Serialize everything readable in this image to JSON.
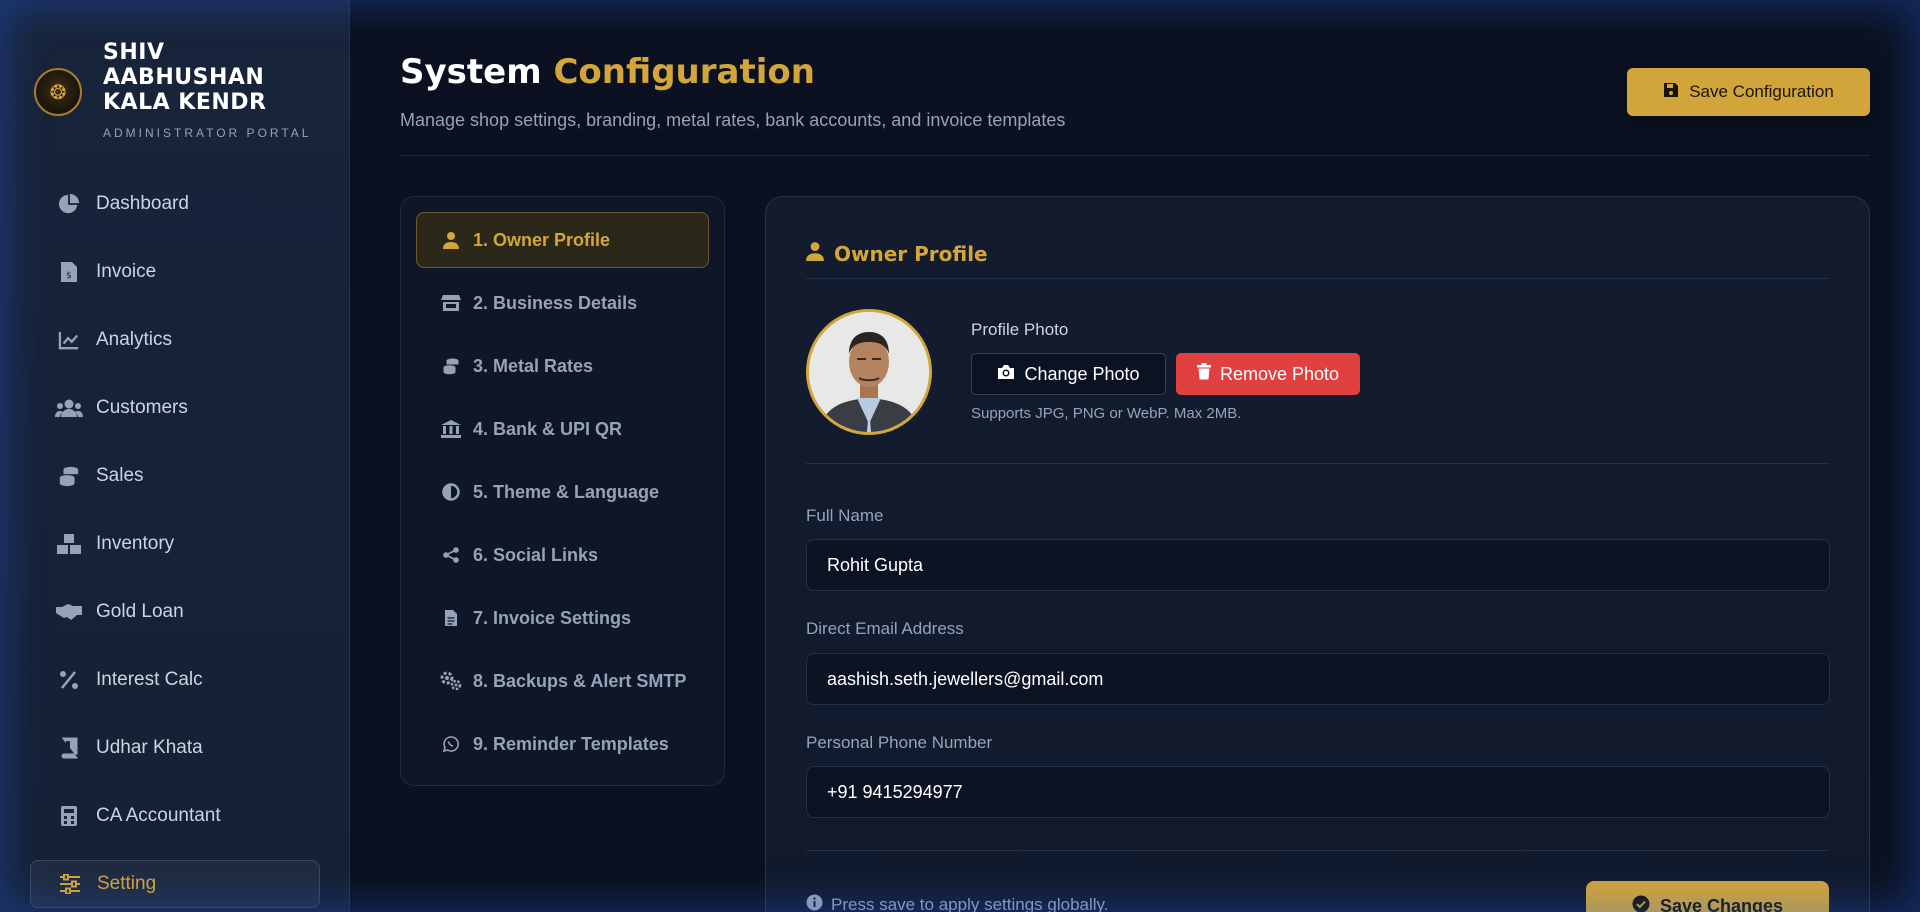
{
  "brand": {
    "name": "SHIV AABHUSHAN KALA KENDR",
    "subtitle": "ADMINISTRATOR PORTAL"
  },
  "sidebar": {
    "items": [
      {
        "label": "Dashboard",
        "icon": "pie-chart-icon"
      },
      {
        "label": "Invoice",
        "icon": "invoice-icon"
      },
      {
        "label": "Analytics",
        "icon": "line-chart-icon"
      },
      {
        "label": "Customers",
        "icon": "users-icon"
      },
      {
        "label": "Sales",
        "icon": "coins-icon"
      },
      {
        "label": "Inventory",
        "icon": "boxes-icon"
      },
      {
        "label": "Gold Loan",
        "icon": "handshake-icon"
      },
      {
        "label": "Interest Calc",
        "icon": "percent-icon"
      },
      {
        "label": "Udhar Khata",
        "icon": "book-icon"
      },
      {
        "label": "CA Accountant",
        "icon": "calculator-icon"
      },
      {
        "label": "Setting",
        "icon": "sliders-icon",
        "active": true
      }
    ]
  },
  "header": {
    "title_part1": "System",
    "title_part2": "Configuration",
    "subtitle": "Manage shop settings, branding, metal rates, bank accounts, and invoice templates",
    "save_label": "Save Configuration"
  },
  "tabs": [
    {
      "label": "1. Owner Profile",
      "icon": "user-icon",
      "active": true
    },
    {
      "label": "2. Business Details",
      "icon": "store-icon"
    },
    {
      "label": "3. Metal Rates",
      "icon": "coins-icon"
    },
    {
      "label": "4. Bank & UPI QR",
      "icon": "bank-icon"
    },
    {
      "label": "5. Theme & Language",
      "icon": "contrast-icon"
    },
    {
      "label": "6. Social Links",
      "icon": "share-icon"
    },
    {
      "label": "7. Invoice Settings",
      "icon": "file-icon"
    },
    {
      "label": "8. Backups & Alert SMTP",
      "icon": "gears-icon"
    },
    {
      "label": "9. Reminder Templates",
      "icon": "whatsapp-icon"
    }
  ],
  "panel": {
    "title": "Owner Profile",
    "photo_label": "Profile Photo",
    "change_photo": "Change Photo",
    "remove_photo": "Remove Photo",
    "photo_hint": "Supports JPG, PNG or WebP. Max 2MB.",
    "full_name_label": "Full Name",
    "full_name_value": "Rohit Gupta",
    "email_label": "Direct Email Address",
    "email_value": "aashish.seth.jewellers@gmail.com",
    "phone_label": "Personal Phone Number",
    "phone_value": "+91 9415294977",
    "footer_note": "Press save to apply settings globally.",
    "save_changes": "Save Changes"
  },
  "colors": {
    "accent": "#d4a63a",
    "danger": "#e04040",
    "background": "#0b1120"
  }
}
